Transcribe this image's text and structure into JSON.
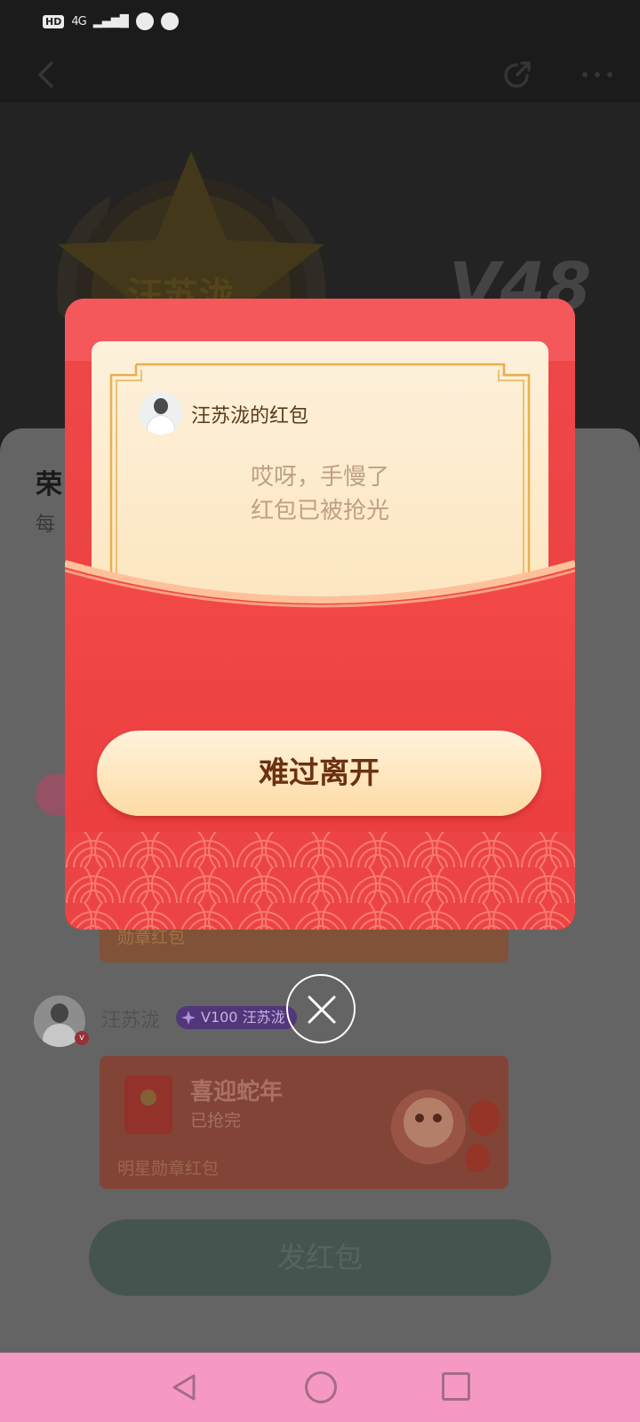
{
  "status_bar": {
    "hd": "HD",
    "signal": "4G",
    "icons": [
      "globe-icon",
      "wechat-icon"
    ]
  },
  "topbar": {
    "icons": [
      "back-icon",
      "share-icon",
      "more-icon"
    ]
  },
  "hero": {
    "badge_name": "汪苏泷",
    "level": "V48"
  },
  "sheet": {
    "title": "荣",
    "subtitle": "每",
    "prev_card_label": "勋章红包",
    "user": {
      "name": "汪苏泷",
      "vip_level": "V100",
      "vip_tag": "汪苏泷"
    },
    "red_packet_card": {
      "title": "喜迎蛇年",
      "status": "已抢完",
      "footer": "明星勋章红包"
    },
    "send_button": "发红包"
  },
  "modal": {
    "sender": "汪苏泷的红包",
    "message_line1": "哎呀，手慢了",
    "message_line2": "红包已被抢光",
    "leave_button": "难过离开",
    "colors": {
      "envelope": "#e83c3c",
      "letter": "#fde6c0",
      "button_text": "#6b3110"
    }
  },
  "navbar": {
    "icons": [
      "nav-back-icon",
      "nav-home-icon",
      "nav-recent-icon"
    ]
  }
}
